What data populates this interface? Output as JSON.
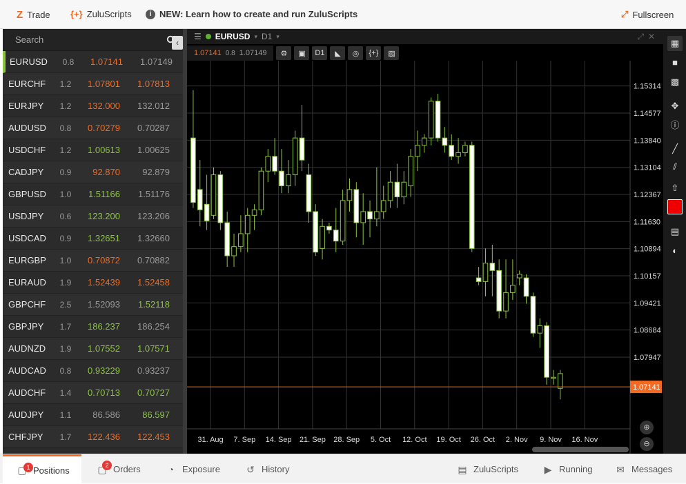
{
  "topbar": {
    "trade_label": "Trade",
    "zuluscripts_label": "ZuluScripts",
    "news_label": "NEW: Learn how to create and run ZuluScripts",
    "fullscreen_label": "Fullscreen"
  },
  "search": {
    "placeholder": "Search"
  },
  "watchlist": [
    {
      "symbol": "EURUSD",
      "spread": "0.8",
      "bid": "1.07141",
      "ask": "1.07149",
      "bid_dir": "dn",
      "ask_dir": "nu"
    },
    {
      "symbol": "EURCHF",
      "spread": "1.2",
      "bid": "1.07801",
      "ask": "1.07813",
      "bid_dir": "dn",
      "ask_dir": "dn"
    },
    {
      "symbol": "EURJPY",
      "spread": "1.2",
      "bid": "132.000",
      "ask": "132.012",
      "bid_dir": "dn",
      "ask_dir": "nu"
    },
    {
      "symbol": "AUDUSD",
      "spread": "0.8",
      "bid": "0.70279",
      "ask": "0.70287",
      "bid_dir": "dn",
      "ask_dir": "nu"
    },
    {
      "symbol": "USDCHF",
      "spread": "1.2",
      "bid": "1.00613",
      "ask": "1.00625",
      "bid_dir": "up",
      "ask_dir": "nu"
    },
    {
      "symbol": "CADJPY",
      "spread": "0.9",
      "bid": "92.870",
      "ask": "92.879",
      "bid_dir": "dn",
      "ask_dir": "nu"
    },
    {
      "symbol": "GBPUSD",
      "spread": "1.0",
      "bid": "1.51166",
      "ask": "1.51176",
      "bid_dir": "up",
      "ask_dir": "nu"
    },
    {
      "symbol": "USDJPY",
      "spread": "0.6",
      "bid": "123.200",
      "ask": "123.206",
      "bid_dir": "up",
      "ask_dir": "nu"
    },
    {
      "symbol": "USDCAD",
      "spread": "0.9",
      "bid": "1.32651",
      "ask": "1.32660",
      "bid_dir": "up",
      "ask_dir": "nu"
    },
    {
      "symbol": "EURGBP",
      "spread": "1.0",
      "bid": "0.70872",
      "ask": "0.70882",
      "bid_dir": "dn",
      "ask_dir": "nu"
    },
    {
      "symbol": "EURAUD",
      "spread": "1.9",
      "bid": "1.52439",
      "ask": "1.52458",
      "bid_dir": "dn",
      "ask_dir": "dn"
    },
    {
      "symbol": "GBPCHF",
      "spread": "2.5",
      "bid": "1.52093",
      "ask": "1.52118",
      "bid_dir": "nu",
      "ask_dir": "up"
    },
    {
      "symbol": "GBPJPY",
      "spread": "1.7",
      "bid": "186.237",
      "ask": "186.254",
      "bid_dir": "up",
      "ask_dir": "nu"
    },
    {
      "symbol": "AUDNZD",
      "spread": "1.9",
      "bid": "1.07552",
      "ask": "1.07571",
      "bid_dir": "up",
      "ask_dir": "up"
    },
    {
      "symbol": "AUDCAD",
      "spread": "0.8",
      "bid": "0.93229",
      "ask": "0.93237",
      "bid_dir": "up",
      "ask_dir": "nu"
    },
    {
      "symbol": "AUDCHF",
      "spread": "1.4",
      "bid": "0.70713",
      "ask": "0.70727",
      "bid_dir": "up",
      "ask_dir": "up"
    },
    {
      "symbol": "AUDJPY",
      "spread": "1.1",
      "bid": "86.586",
      "ask": "86.597",
      "bid_dir": "nu",
      "ask_dir": "up"
    },
    {
      "symbol": "CHFJPY",
      "spread": "1.7",
      "bid": "122.436",
      "ask": "122.453",
      "bid_dir": "dn",
      "ask_dir": "dn"
    }
  ],
  "chart": {
    "symbol": "EURUSD",
    "timeframe": "D1",
    "bid": "1.07141",
    "spread": "0.8",
    "ask": "1.07149",
    "timeframe_button": "D1",
    "scripts_button": "{+}",
    "current_price": "1.07141",
    "colors": {
      "up": "#000000",
      "down": "#ffffff",
      "wick": "#8cc63f",
      "price_line": "#f26a21"
    }
  },
  "chart_data": {
    "type": "candlestick",
    "ylim": [
      1.06,
      1.16
    ],
    "y_ticks": [
      "1.15314",
      "1.14577",
      "1.13840",
      "1.13104",
      "1.12367",
      "1.11630",
      "1.10894",
      "1.10157",
      "1.09421",
      "1.08684",
      "1.07947"
    ],
    "x_ticks": [
      "31. Aug",
      "7. Sep",
      "14. Sep",
      "21. Sep",
      "28. Sep",
      "5. Oct",
      "12. Oct",
      "19. Oct",
      "26. Oct",
      "2. Nov",
      "9. Nov",
      "16. Nov"
    ],
    "candles": [
      [
        1.139,
        1.152,
        1.12,
        1.1215
      ],
      [
        1.125,
        1.133,
        1.115,
        1.1195
      ],
      [
        1.121,
        1.129,
        1.114,
        1.1165
      ],
      [
        1.118,
        1.131,
        1.117,
        1.129
      ],
      [
        1.129,
        1.13,
        1.114,
        1.116
      ],
      [
        1.116,
        1.119,
        1.104,
        1.107
      ],
      [
        1.107,
        1.113,
        1.104,
        1.1095
      ],
      [
        1.1095,
        1.118,
        1.108,
        1.113
      ],
      [
        1.113,
        1.12,
        1.108,
        1.118
      ],
      [
        1.118,
        1.121,
        1.114,
        1.1195
      ],
      [
        1.1195,
        1.131,
        1.118,
        1.13
      ],
      [
        1.13,
        1.136,
        1.127,
        1.134
      ],
      [
        1.134,
        1.139,
        1.129,
        1.13
      ],
      [
        1.13,
        1.136,
        1.124,
        1.126
      ],
      [
        1.126,
        1.133,
        1.124,
        1.129
      ],
      [
        1.129,
        1.141,
        1.126,
        1.139
      ],
      [
        1.139,
        1.148,
        1.13,
        1.133
      ],
      [
        1.129,
        1.132,
        1.116,
        1.119
      ],
      [
        1.119,
        1.121,
        1.107,
        1.108
      ],
      [
        1.109,
        1.117,
        1.106,
        1.115
      ],
      [
        1.115,
        1.116,
        1.113,
        1.114
      ],
      [
        1.114,
        1.12,
        1.108,
        1.111
      ],
      [
        1.111,
        1.125,
        1.11,
        1.122
      ],
      [
        1.122,
        1.128,
        1.119,
        1.125
      ],
      [
        1.125,
        1.127,
        1.112,
        1.116
      ],
      [
        1.116,
        1.124,
        1.11,
        1.119
      ],
      [
        1.119,
        1.122,
        1.112,
        1.117
      ],
      [
        1.117,
        1.131,
        1.115,
        1.119
      ],
      [
        1.119,
        1.126,
        1.117,
        1.122
      ],
      [
        1.122,
        1.13,
        1.12,
        1.127
      ],
      [
        1.127,
        1.132,
        1.12,
        1.123
      ],
      [
        1.123,
        1.13,
        1.121,
        1.127
      ],
      [
        1.126,
        1.136,
        1.123,
        1.134
      ],
      [
        1.134,
        1.141,
        1.13,
        1.137
      ],
      [
        1.137,
        1.14,
        1.135,
        1.139
      ],
      [
        1.139,
        1.15,
        1.137,
        1.149
      ],
      [
        1.149,
        1.151,
        1.138,
        1.139
      ],
      [
        1.139,
        1.142,
        1.135,
        1.137
      ],
      [
        1.137,
        1.14,
        1.133,
        1.134
      ],
      [
        1.134,
        1.139,
        1.132,
        1.135
      ],
      [
        1.135,
        1.138,
        1.134,
        1.137
      ],
      [
        1.137,
        1.138,
        1.108,
        1.109
      ],
      [
        1.101,
        1.104,
        1.099,
        1.1
      ],
      [
        1.1,
        1.109,
        1.096,
        1.105
      ],
      [
        1.105,
        1.11,
        1.096,
        1.103
      ],
      [
        1.103,
        1.106,
        1.09,
        1.092
      ],
      [
        1.092,
        1.106,
        1.09,
        1.097
      ],
      [
        1.097,
        1.106,
        1.095,
        1.099
      ],
      [
        1.101,
        1.103,
        1.099,
        1.102
      ],
      [
        1.101,
        1.102,
        1.094,
        1.096
      ],
      [
        1.096,
        1.097,
        1.085,
        1.086
      ],
      [
        1.086,
        1.09,
        1.082,
        1.088
      ],
      [
        1.088,
        1.089,
        1.072,
        1.074
      ],
      [
        1.074,
        1.076,
        1.072,
        1.074
      ],
      [
        1.071,
        1.076,
        1.068,
        1.075
      ]
    ]
  },
  "bottom": {
    "positions_label": "Positions",
    "positions_count": "1",
    "orders_label": "Orders",
    "orders_count": "2",
    "exposure_label": "Exposure",
    "history_label": "History",
    "zuluscripts_label": "ZuluScripts",
    "running_label": "Running",
    "messages_label": "Messages"
  }
}
